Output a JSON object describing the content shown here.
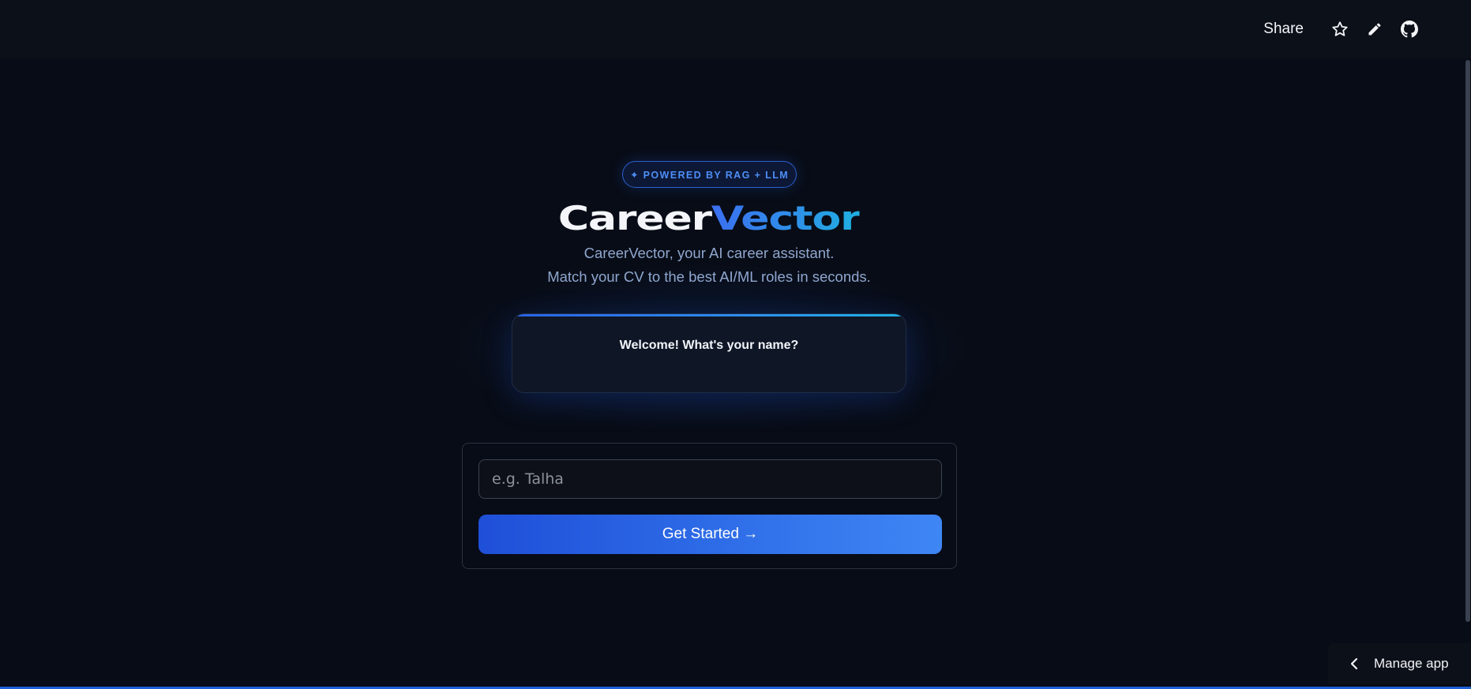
{
  "topbar": {
    "share_label": "Share",
    "icons": [
      "star-icon",
      "pencil-icon",
      "github-icon"
    ]
  },
  "hero": {
    "badge": "✦ POWERED BY RAG + LLM",
    "brand_part1": "Career",
    "brand_part2": "Vector",
    "subtitle_line1": "CareerVector, your AI career assistant.",
    "subtitle_line2": "Match your CV to the best AI/ML roles in seconds."
  },
  "welcome": {
    "prompt": "Welcome! What's your name?"
  },
  "form": {
    "name_placeholder": "e.g. Talha",
    "name_value": "",
    "submit_label": "Get Started →"
  },
  "footer": {
    "manage_app_label": "Manage app"
  },
  "colors": {
    "background": "#080c16",
    "accent": "#2f6ee8",
    "badge_text": "#4d8ef7"
  }
}
